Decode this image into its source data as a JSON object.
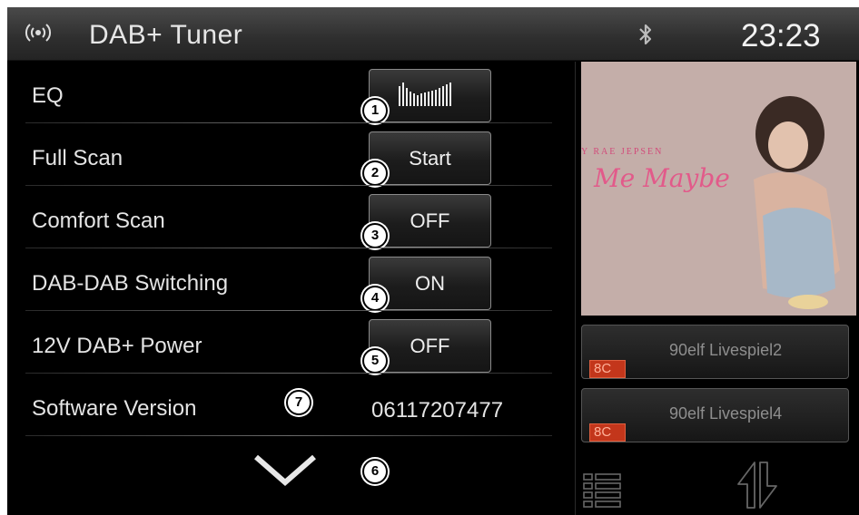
{
  "header": {
    "title": "DAB+ Tuner",
    "clock": "23:23"
  },
  "settings": [
    {
      "label": "EQ",
      "control": "icon",
      "icon": "equalizer-icon",
      "badge": "1"
    },
    {
      "label": "Full Scan",
      "control": "button",
      "value": "Start",
      "badge": "2"
    },
    {
      "label": "Comfort Scan",
      "control": "button",
      "value": "OFF",
      "badge": "3"
    },
    {
      "label": "DAB-DAB Switching",
      "control": "button",
      "value": "ON",
      "badge": "4"
    },
    {
      "label": "12V DAB+ Power",
      "control": "button",
      "value": "OFF",
      "badge": "5"
    },
    {
      "label": "Software Version",
      "control": "text",
      "value": "06117207477",
      "badge": "7"
    }
  ],
  "scroll_badge": "6",
  "album": {
    "artist": "Y RAE JEPSEN",
    "title": "Me Maybe"
  },
  "stations": [
    {
      "name": "90elf Livespiel2",
      "tag": "8C"
    },
    {
      "name": "90elf Livespiel4",
      "tag": "8C"
    }
  ],
  "icons": {
    "broadcast": "radio-signal-icon",
    "bluetooth": "bluetooth-icon",
    "scroll": "chevron-down-icon",
    "list": "list-icon",
    "swap": "swap-arrows-icon"
  },
  "colors": {
    "background": "#000000",
    "header": "#3a3a3a",
    "station_tag": "#c3361b",
    "text": "#e4e4e4"
  }
}
